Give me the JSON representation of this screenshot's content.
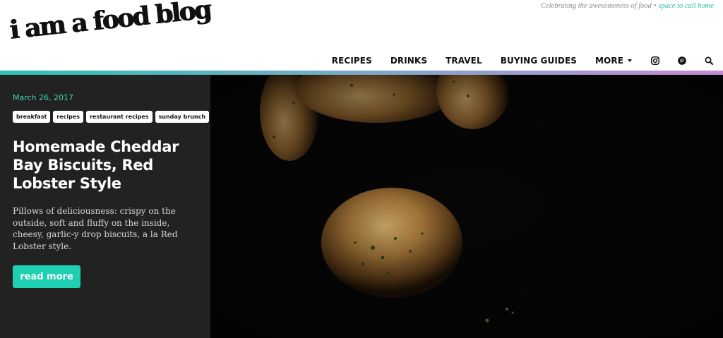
{
  "site": {
    "logo": "i am a food blog",
    "tagline": "Celebrating the awesomeness of food",
    "tagline_separator": "•",
    "tagline_link": "space to call home"
  },
  "nav": {
    "items": [
      {
        "label": "RECIPES"
      },
      {
        "label": "DRINKS"
      },
      {
        "label": "TRAVEL"
      },
      {
        "label": "BUYING GUIDES"
      },
      {
        "label": "MORE"
      }
    ],
    "icons": [
      "instagram-icon",
      "pinterest-icon",
      "search-icon"
    ]
  },
  "post": {
    "date": "March 26, 2017",
    "tags": [
      "breakfast",
      "recipes",
      "restaurant recipes",
      "sunday brunch"
    ],
    "title": "Homemade Cheddar Bay Biscuits, Red Lobster Style",
    "excerpt": "Pillows of deliciousness: crispy on the outside, soft and fluffy on the inside, cheesy, garlic-y drop biscuits, a la Red Lobster style.",
    "cta": "read more"
  },
  "colors": {
    "accent": "#1fcfb2",
    "panel": "#222222",
    "gradient_start": "#2fc0b4",
    "gradient_end": "#c58bd6"
  }
}
